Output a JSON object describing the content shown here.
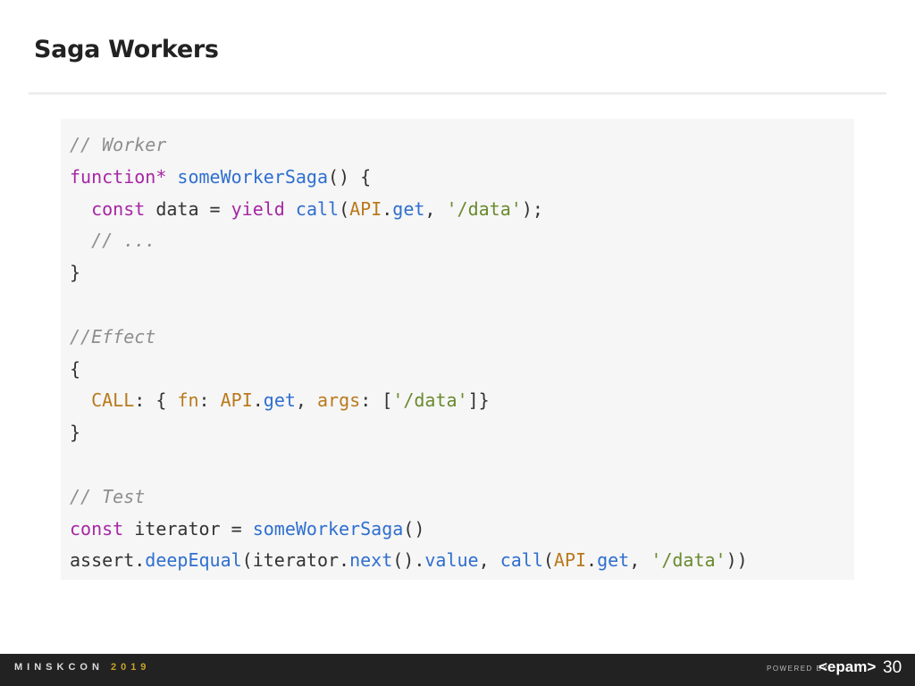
{
  "slide": {
    "title": "Saga Workers",
    "page_number": "30"
  },
  "code": {
    "lines": [
      [
        {
          "t": "// Worker",
          "c": "comment"
        }
      ],
      [
        {
          "t": "function*",
          "c": "kw"
        },
        {
          "t": " ",
          "c": "plain"
        },
        {
          "t": "someWorkerSaga",
          "c": "fn"
        },
        {
          "t": "() {",
          "c": "punct"
        }
      ],
      [
        {
          "t": "  ",
          "c": "plain"
        },
        {
          "t": "const",
          "c": "kw"
        },
        {
          "t": " data = ",
          "c": "plain"
        },
        {
          "t": "yield",
          "c": "kw"
        },
        {
          "t": " ",
          "c": "plain"
        },
        {
          "t": "call",
          "c": "fn"
        },
        {
          "t": "(",
          "c": "punct"
        },
        {
          "t": "API",
          "c": "prop"
        },
        {
          "t": ".",
          "c": "punct"
        },
        {
          "t": "get",
          "c": "fn"
        },
        {
          "t": ", ",
          "c": "punct"
        },
        {
          "t": "'/data'",
          "c": "str"
        },
        {
          "t": ");",
          "c": "punct"
        }
      ],
      [
        {
          "t": "  // ...",
          "c": "comment"
        }
      ],
      [
        {
          "t": "}",
          "c": "punct"
        }
      ],
      [
        {
          "t": "",
          "c": "plain"
        }
      ],
      [
        {
          "t": "//Effect",
          "c": "comment"
        }
      ],
      [
        {
          "t": "{",
          "c": "punct"
        }
      ],
      [
        {
          "t": "  ",
          "c": "plain"
        },
        {
          "t": "CALL",
          "c": "prop"
        },
        {
          "t": ": { ",
          "c": "punct"
        },
        {
          "t": "fn",
          "c": "prop"
        },
        {
          "t": ": ",
          "c": "punct"
        },
        {
          "t": "API",
          "c": "prop"
        },
        {
          "t": ".",
          "c": "punct"
        },
        {
          "t": "get",
          "c": "fn"
        },
        {
          "t": ", ",
          "c": "punct"
        },
        {
          "t": "args",
          "c": "prop"
        },
        {
          "t": ": [",
          "c": "punct"
        },
        {
          "t": "'/data'",
          "c": "str"
        },
        {
          "t": "]}",
          "c": "punct"
        }
      ],
      [
        {
          "t": "}",
          "c": "punct"
        }
      ],
      [
        {
          "t": "",
          "c": "plain"
        }
      ],
      [
        {
          "t": "// Test",
          "c": "comment"
        }
      ],
      [
        {
          "t": "const",
          "c": "kw"
        },
        {
          "t": " iterator = ",
          "c": "plain"
        },
        {
          "t": "someWorkerSaga",
          "c": "fn"
        },
        {
          "t": "()",
          "c": "punct"
        }
      ],
      [
        {
          "t": "assert",
          "c": "plain"
        },
        {
          "t": ".",
          "c": "punct"
        },
        {
          "t": "deepEqual",
          "c": "fn"
        },
        {
          "t": "(iterator.",
          "c": "plain"
        },
        {
          "t": "next",
          "c": "fn"
        },
        {
          "t": "().",
          "c": "punct"
        },
        {
          "t": "value",
          "c": "fn"
        },
        {
          "t": ", ",
          "c": "punct"
        },
        {
          "t": "call",
          "c": "fn"
        },
        {
          "t": "(",
          "c": "punct"
        },
        {
          "t": "API",
          "c": "prop"
        },
        {
          "t": ".",
          "c": "punct"
        },
        {
          "t": "get",
          "c": "fn"
        },
        {
          "t": ", ",
          "c": "punct"
        },
        {
          "t": "'/data'",
          "c": "str"
        },
        {
          "t": "))",
          "c": "punct"
        }
      ]
    ]
  },
  "footer": {
    "conference_prefix": "MINSKCON ",
    "year": "2019",
    "powered_by": "POWERED BY",
    "brand": "<epam>"
  },
  "colors": {
    "comment": "#8e8e8e",
    "keyword": "#a626a4",
    "function": "#2f6fcf",
    "string": "#6a8a2e",
    "property": "#b97a1c",
    "footer_bg": "#222222",
    "code_bg": "#f6f6f6"
  }
}
